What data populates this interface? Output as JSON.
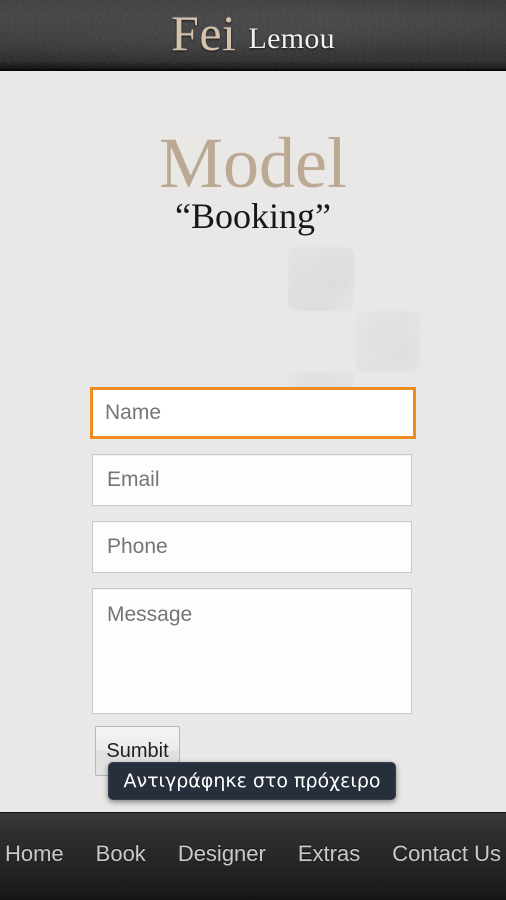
{
  "header": {
    "brand_first": "Fei",
    "brand_last": "Lemou"
  },
  "main": {
    "title": "Model",
    "subtitle": "“Booking”"
  },
  "form": {
    "fields": [
      {
        "name": "name",
        "placeholder": "Name",
        "value": "",
        "focused": true
      },
      {
        "name": "email",
        "placeholder": "Email",
        "value": "",
        "focused": false
      },
      {
        "name": "phone",
        "placeholder": "Phone",
        "value": "",
        "focused": false
      },
      {
        "name": "message",
        "placeholder": "Message",
        "value": "",
        "focused": false
      }
    ],
    "name_placeholder": "Name",
    "email_placeholder": "Email",
    "phone_placeholder": "Phone",
    "message_placeholder": "Message",
    "submit_label": "Sumbit"
  },
  "toast": {
    "text": "Αντιγράφηκε στο πρόχειρο",
    "background": "#262f3b",
    "text_color": "#ffffff"
  },
  "bottom_nav": {
    "items": [
      {
        "label": "Home"
      },
      {
        "label": "Book"
      },
      {
        "label": "Designer"
      },
      {
        "label": "Extras"
      },
      {
        "label": "Contact Us"
      }
    ]
  },
  "colors": {
    "page_background": "#e9e8e6",
    "header_background": "#3a3a3a",
    "brand_accent": "#d5c2ae",
    "title_accent": "#bba993",
    "focus_border": "#ee8c1f",
    "field_border": "#c9c9c7",
    "nav_text": "#c9c9c9"
  }
}
